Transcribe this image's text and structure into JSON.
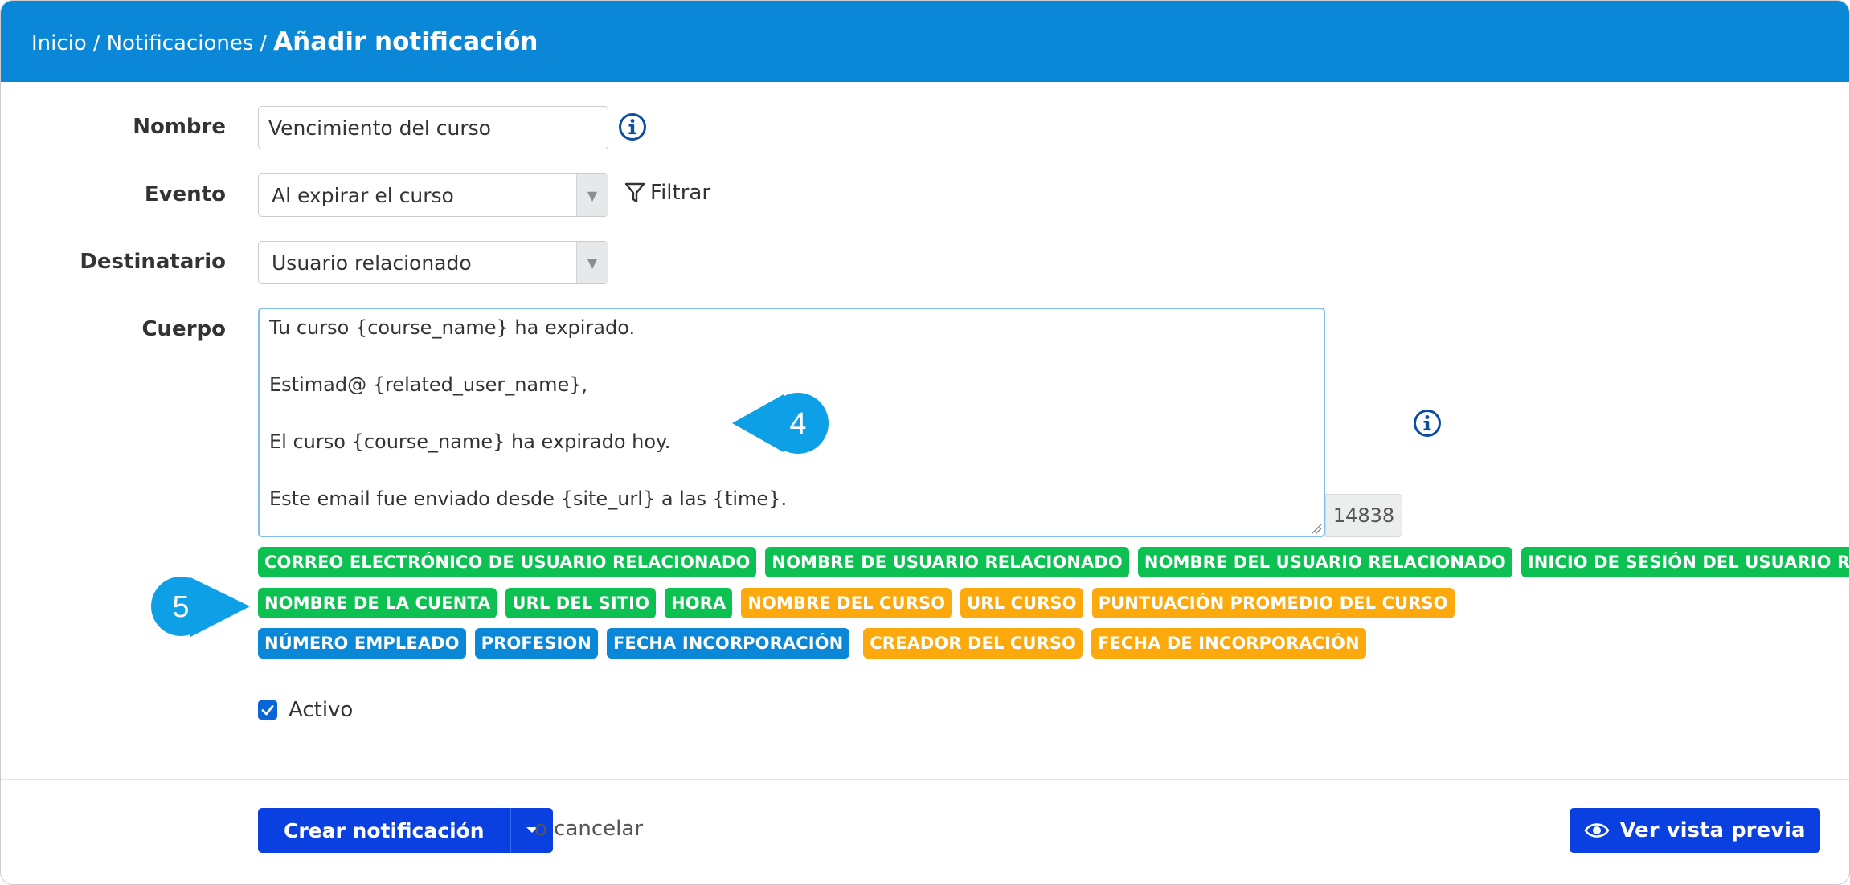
{
  "breadcrumb": {
    "home": "Inicio",
    "section": "Notificaciones",
    "separator": "/",
    "current": "Añadir notificación"
  },
  "form": {
    "name_label": "Nombre",
    "name_value": "Vencimiento del curso",
    "event_label": "Evento",
    "event_value": "Al expirar el curso",
    "filter_label": "Filtrar",
    "recipient_label": "Destinatario",
    "recipient_value": "Usuario relacionado",
    "body_label": "Cuerpo",
    "body_lines": [
      "Tu curso {course_name} ha expirado.",
      "",
      "Estimad@ {related_user_name},",
      "",
      "El curso {course_name} ha expirado hoy.",
      "",
      "Este email fue enviado desde {site_url} a las {time}."
    ],
    "char_count": "14838",
    "active_label": "Activo",
    "active_checked": true
  },
  "tags": {
    "row1": [
      {
        "label": "CORREO ELECTRÓNICO DE USUARIO RELACIONADO",
        "color": "green"
      },
      {
        "label": "NOMBRE DE USUARIO RELACIONADO",
        "color": "green"
      },
      {
        "label": "NOMBRE DEL USUARIO RELACIONADO",
        "color": "green"
      },
      {
        "label": "INICIO DE SESIÓN DEL USUARIO RELACIONADO",
        "color": "green"
      }
    ],
    "row2": [
      {
        "label": "NOMBRE DE LA CUENTA",
        "color": "green"
      },
      {
        "label": "URL DEL SITIO",
        "color": "green"
      },
      {
        "label": "HORA",
        "color": "green"
      },
      {
        "label": "NOMBRE DEL CURSO",
        "color": "orange"
      },
      {
        "label": "URL CURSO",
        "color": "orange"
      },
      {
        "label": "PUNTUACIÓN PROMEDIO DEL CURSO",
        "color": "orange"
      }
    ],
    "row3": [
      {
        "label": "NÚMERO EMPLEADO",
        "color": "blue"
      },
      {
        "label": "PROFESION",
        "color": "blue"
      },
      {
        "label": "FECHA INCORPORACIÓN",
        "color": "blue"
      },
      {
        "label": "CREADOR DEL CURSO",
        "color": "orange"
      },
      {
        "label": "FECHA DE INCORPORACIÓN",
        "color": "orange"
      }
    ]
  },
  "callouts": {
    "first": "4",
    "second": "5"
  },
  "actions": {
    "create_label": "Crear notificación",
    "cancel_label": "o cancelar",
    "preview_label": "Ver vista previa"
  },
  "colors": {
    "header": "#0a87d7",
    "primary_button": "#0a3fe0",
    "tag_green": "#0cc152",
    "tag_orange": "#fba90c",
    "tag_blue": "#0a87d7",
    "callout": "#0ea0e6"
  },
  "icons": [
    "info-icon",
    "filter-icon",
    "caret-down-icon",
    "check-icon",
    "eye-icon",
    "resize-handle-icon"
  ]
}
